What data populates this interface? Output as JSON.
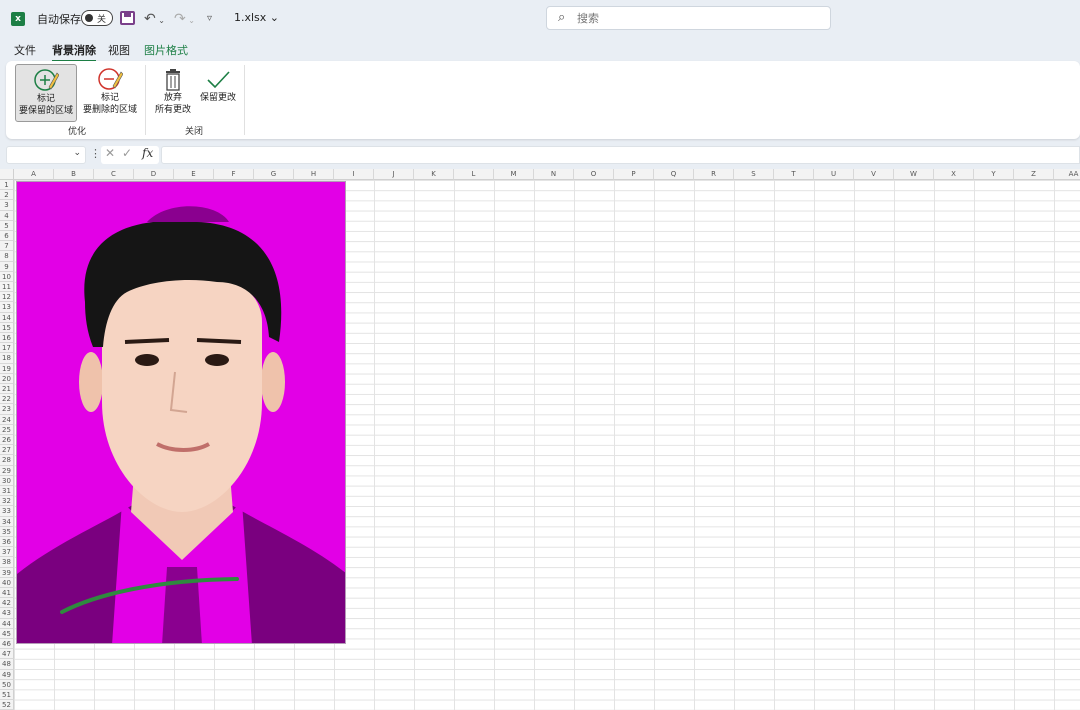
{
  "titlebar": {
    "autosave_label": "自动保存",
    "autosave_state": "关",
    "filename": "1.xlsx",
    "search_placeholder": "搜索"
  },
  "tabs": [
    {
      "label": "文件"
    },
    {
      "label": "背景消除",
      "active": true
    },
    {
      "label": "视图"
    },
    {
      "label": "图片格式"
    }
  ],
  "ribbon": {
    "groups": [
      {
        "label": "优化",
        "buttons": [
          {
            "line1": "标记",
            "line2": "要保留的区域",
            "icon": "mark-keep-icon"
          },
          {
            "line1": "标记",
            "line2": "要删除的区域",
            "icon": "mark-remove-icon"
          }
        ]
      },
      {
        "label": "关闭",
        "buttons": [
          {
            "line1": "放弃",
            "line2": "所有更改",
            "icon": "discard-icon"
          },
          {
            "line1": "保留更改",
            "line2": "",
            "icon": "keep-changes-icon"
          }
        ]
      }
    ]
  },
  "formula_bar": {
    "fx": "fx",
    "cancel": "✕",
    "confirm": "✓",
    "dots": "⋮"
  },
  "sheet": {
    "columns": [
      "A",
      "B",
      "C",
      "D",
      "E",
      "F",
      "G",
      "H",
      "I",
      "J",
      "K",
      "L",
      "M",
      "N",
      "O",
      "P",
      "Q",
      "R",
      "S",
      "T",
      "U",
      "V",
      "W",
      "X",
      "Y",
      "Z",
      "AA"
    ],
    "row_count": 52
  },
  "colors": {
    "accent": "#1d7f45",
    "background_removal_magenta": "#e200e6",
    "suit": "#7a007f"
  }
}
